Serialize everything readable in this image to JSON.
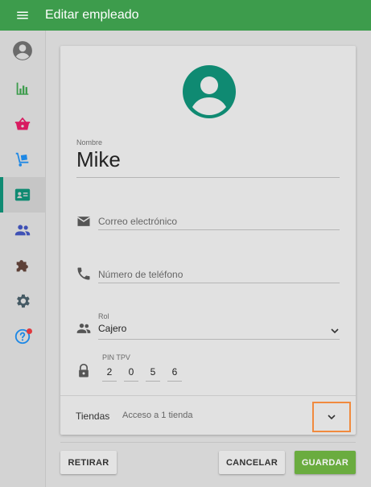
{
  "header": {
    "title": "Editar empleado",
    "menu_icon": "menu-icon"
  },
  "sidebar": {
    "items": [
      {
        "id": "account",
        "icon": "account-circle-icon",
        "color": "#6b6b6b"
      },
      {
        "id": "reports",
        "icon": "bar-chart-icon",
        "color": "#3d9c4c"
      },
      {
        "id": "sales",
        "icon": "basket-icon",
        "color": "#d81b60"
      },
      {
        "id": "inventory",
        "icon": "dolly-icon",
        "color": "#1e88e5"
      },
      {
        "id": "employees",
        "icon": "badge-icon",
        "color": "#0f8a72",
        "active": true
      },
      {
        "id": "customers",
        "icon": "people-icon",
        "color": "#3f51b5"
      },
      {
        "id": "integrations",
        "icon": "puzzle-icon",
        "color": "#5d4037"
      },
      {
        "id": "settings",
        "icon": "gear-icon",
        "color": "#455a64"
      },
      {
        "id": "help",
        "icon": "help-icon",
        "color": "#1e88e5",
        "badge_color": "#e0393e"
      }
    ]
  },
  "form": {
    "avatar_color": "#0f8a72",
    "name_label": "Nombre",
    "name_value": "Mike",
    "email_placeholder": "Correo electrónico",
    "phone_placeholder": "Número de teléfono",
    "role_label": "Rol",
    "role_value": "Cajero",
    "pin_label": "PIN TPV",
    "pin_digits": [
      "2",
      "0",
      "5",
      "6"
    ],
    "stores_label": "Tiendas",
    "stores_value": "Acceso a 1 tienda"
  },
  "actions": {
    "delete_label": "RETIRAR",
    "cancel_label": "CANCELAR",
    "save_label": "GUARDAR"
  },
  "colors": {
    "topbar": "#3d9c4c",
    "accent": "#0f8a72",
    "primary_button": "#6aac3f",
    "highlight": "#f08a3e"
  }
}
